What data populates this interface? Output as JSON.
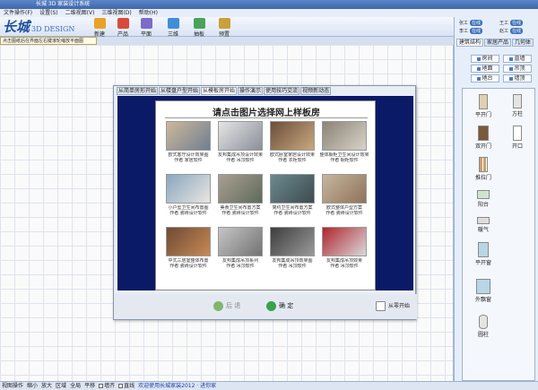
{
  "app": {
    "title": "长城 3D 家装设计系统"
  },
  "menu": [
    "文件操作(F)",
    "设置(S)",
    "二维视图(V)",
    "三维视图(D)",
    "帮助(H)"
  ],
  "toolbar": {
    "logo": "长城",
    "logo_sub": "3D DESIGN",
    "buttons": [
      {
        "label": "新建",
        "color": "#e9a227"
      },
      {
        "label": "产品",
        "color": "#d84b3a"
      },
      {
        "label": "平面",
        "color": "#7d6bc9"
      },
      {
        "label": "三维",
        "color": "#3f8ed6"
      },
      {
        "label": "抽板",
        "color": "#4aa35a"
      },
      {
        "label": "预置",
        "color": "#c9a13a"
      }
    ]
  },
  "hint": "点击图纸后在界面左右键滚轮缩放平面图",
  "users": [
    {
      "name": "张工",
      "tag": "在线"
    },
    {
      "name": "王工",
      "tag": "在线"
    },
    {
      "name": "李工",
      "tag": "在线"
    },
    {
      "name": "赵工",
      "tag": "在线"
    }
  ],
  "right_panel": {
    "tabs": [
      "建筑结构",
      "家居产品",
      "几何体"
    ],
    "buttons": [
      "房间",
      "直墙",
      "地面",
      "吊顶",
      "地台",
      "墙顶"
    ],
    "items": [
      "平开门",
      "方柱",
      "双开门",
      "开口",
      "推拉门",
      "阳台",
      "暖气",
      "平开窗",
      "外飘窗",
      "圆柱"
    ]
  },
  "dialog": {
    "tabs": [
      "从简单房形开始",
      "从楼盘户型开始",
      "从模板房开始",
      "操作演示",
      "使用技巧交流",
      "视频新动态"
    ],
    "active_tab": 2,
    "page_title": "请点击图片选择网上样板房",
    "thumbs": [
      {
        "l1": "欧式客厅设计效果图",
        "l2": "作者 家居软件",
        "c1": "#cdb89a",
        "c2": "#6f7f92"
      },
      {
        "l1": "友邦集成吊顶设计效果",
        "l2": "作者 吊顶软件",
        "c1": "#e5e5e5",
        "c2": "#8a8f99"
      },
      {
        "l1": "欧式卧室家居设计效果",
        "l2": "作者 衣柜软件",
        "c1": "#6b4e3a",
        "c2": "#c9a87f"
      },
      {
        "l1": "整体橱柜卫生间设计效果",
        "l2": "作者 橱柜软件",
        "c1": "#8b8376",
        "c2": "#d8d2c6"
      },
      {
        "l1": "小户型卫生间布置图",
        "l2": "作者 瓷砖设计软件",
        "c1": "#8aa6bf",
        "c2": "#e8e6e0"
      },
      {
        "l1": "美食卫生间布置方案",
        "l2": "作者 瓷砖设计软件",
        "c1": "#a9a091",
        "c2": "#5f6a5a"
      },
      {
        "l1": "简约卫生间布置方案",
        "l2": "作者 瓷砖设计软件",
        "c1": "#6c8a8f",
        "c2": "#3d4b4f"
      },
      {
        "l1": "欧式整体户型方案",
        "l2": "作者 瓷砖设计软件",
        "c1": "#c7b6a0",
        "c2": "#8e7357"
      },
      {
        "l1": "中式三居室整体布置",
        "l2": "作者 瓷砖设计软件",
        "c1": "#6e4a35",
        "c2": "#c88a54"
      },
      {
        "l1": "友邦集成吊顶系列",
        "l2": "作者 吊顶软件",
        "c1": "#c6c6c6",
        "c2": "#727272"
      },
      {
        "l1": "友邦集成吊顶效果图",
        "l2": "作者 吊顶软件",
        "c1": "#3d3d3d",
        "c2": "#9a9a9a"
      },
      {
        "l1": "友邦集成吊顶效果",
        "l2": "作者 吊顶软件",
        "c1": "#b0242e",
        "c2": "#d9d9d9"
      }
    ],
    "back_label": "后 退",
    "ok_label": "确 定",
    "start_label": "从零开始"
  },
  "statusbar": {
    "items": [
      "视图操作",
      "缩小",
      "放大",
      "区域",
      "全局",
      "平移"
    ],
    "checks": [
      "墙齐",
      "直线"
    ],
    "message": "欢迎使用长城家装2012 · 进你家"
  }
}
